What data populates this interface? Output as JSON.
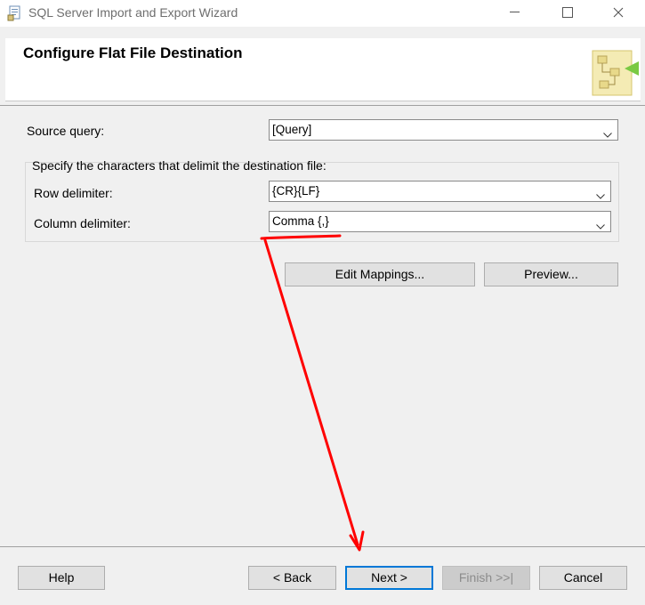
{
  "window": {
    "title": "SQL Server Import and Export Wizard",
    "app_icon": "ssis-wizard-icon",
    "controls": [
      "minimize-icon",
      "maximize-icon",
      "close-icon"
    ]
  },
  "header": {
    "title": "Configure Flat File Destination",
    "graphic": "wizard-graphic-icon"
  },
  "form": {
    "source_query_label": "Source query:",
    "source_query_value": "[Query]",
    "delimiters_group_label": "Specify the characters that delimit the destination file:",
    "row_delimiter_label": "Row delimiter:",
    "row_delimiter_value": "{CR}{LF}",
    "column_delimiter_label": "Column delimiter:",
    "column_delimiter_value": "Comma {,}"
  },
  "actions": {
    "edit_mappings": "Edit Mappings...",
    "preview": "Preview..."
  },
  "footer": {
    "help": "Help",
    "back": "< Back",
    "next": "Next >",
    "finish": "Finish >>|",
    "cancel": "Cancel"
  },
  "colors": {
    "annotation": "#ff0000",
    "accent": "#0078d7",
    "background": "#f0f0f0"
  }
}
